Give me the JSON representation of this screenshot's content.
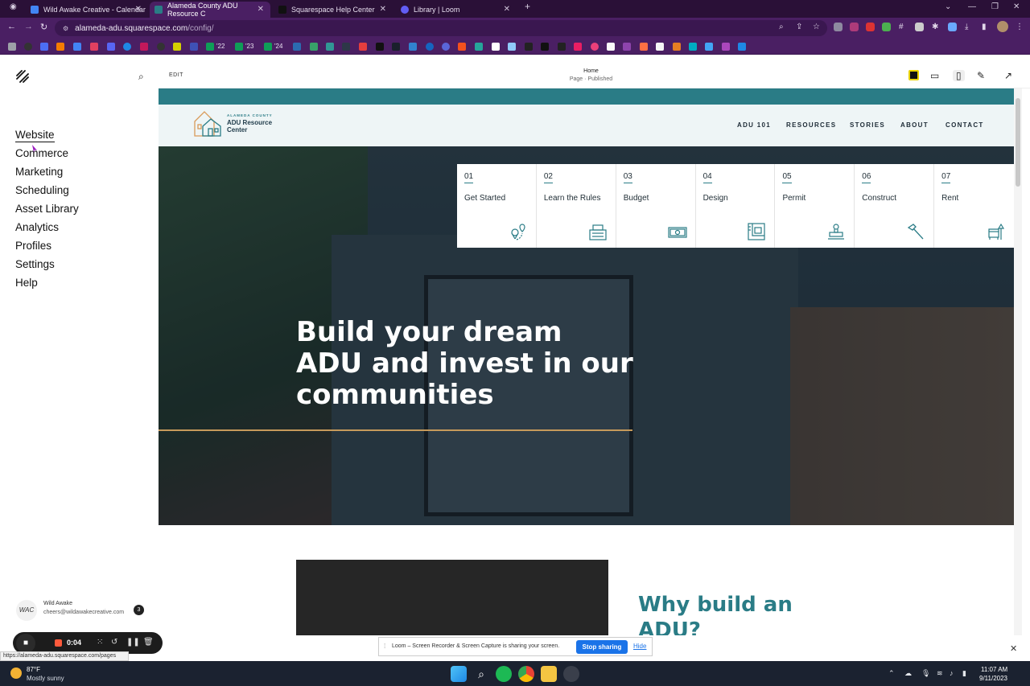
{
  "browser": {
    "tabs": [
      {
        "label": "Wild Awake Creative - Calendar"
      },
      {
        "label": "Alameda County ADU Resource C"
      },
      {
        "label": "Squarespace Help Center"
      },
      {
        "label": "Library | Loom"
      }
    ],
    "new_tab": "+",
    "url_host": "alameda-adu.squarespace.com",
    "url_path": "/config/",
    "bookmarks_text": [
      "'22",
      "'23",
      "'24"
    ]
  },
  "sidebar": {
    "items": [
      {
        "label": "Website"
      },
      {
        "label": "Commerce"
      },
      {
        "label": "Marketing"
      },
      {
        "label": "Scheduling"
      },
      {
        "label": "Asset Library"
      },
      {
        "label": "Analytics"
      },
      {
        "label": "Profiles"
      },
      {
        "label": "Settings"
      },
      {
        "label": "Help"
      }
    ],
    "account": {
      "initials": "WAC",
      "name": "Wild Awake",
      "email": "cheers@wildawakecreative.com",
      "badge": "3"
    }
  },
  "editor": {
    "edit_label": "EDIT",
    "page_name": "Home",
    "page_status": "Page · Published"
  },
  "site": {
    "logo_line1": "ALAMEDA COUNTY",
    "logo_line2": "ADU Resource",
    "logo_line3": "Center",
    "nav": [
      {
        "label": "ADU 101"
      },
      {
        "label": "RESOURCES"
      },
      {
        "label": "STORIES"
      },
      {
        "label": "ABOUT"
      },
      {
        "label": "CONTACT"
      }
    ],
    "steps": [
      {
        "num": "01",
        "title": "Get Started",
        "icon": "map-pin-icon"
      },
      {
        "num": "02",
        "title": "Learn the Rules",
        "icon": "rules-icon"
      },
      {
        "num": "03",
        "title": "Budget",
        "icon": "money-icon"
      },
      {
        "num": "04",
        "title": "Design",
        "icon": "blueprint-icon"
      },
      {
        "num": "05",
        "title": "Permit",
        "icon": "stamp-icon"
      },
      {
        "num": "06",
        "title": "Construct",
        "icon": "hammer-icon"
      },
      {
        "num": "07",
        "title": "Rent",
        "icon": "furniture-icon"
      }
    ],
    "hero_title": "Build your dream ADU and invest in our communities",
    "why_title": "Why build an ADU?",
    "colors": {
      "teal": "#2a7c86",
      "gold": "#c69a5b"
    }
  },
  "loom": {
    "time": "0:04",
    "status_url": "https://alameda-adu.squarespace.com/pages",
    "share_text": "Loom – Screen Recorder & Screen Capture is sharing your screen.",
    "stop_label": "Stop sharing",
    "hide_label": "Hide"
  },
  "taskbar": {
    "temp": "87°F",
    "weather": "Mostly sunny",
    "time": "11:07 AM",
    "date": "9/11/2023"
  }
}
